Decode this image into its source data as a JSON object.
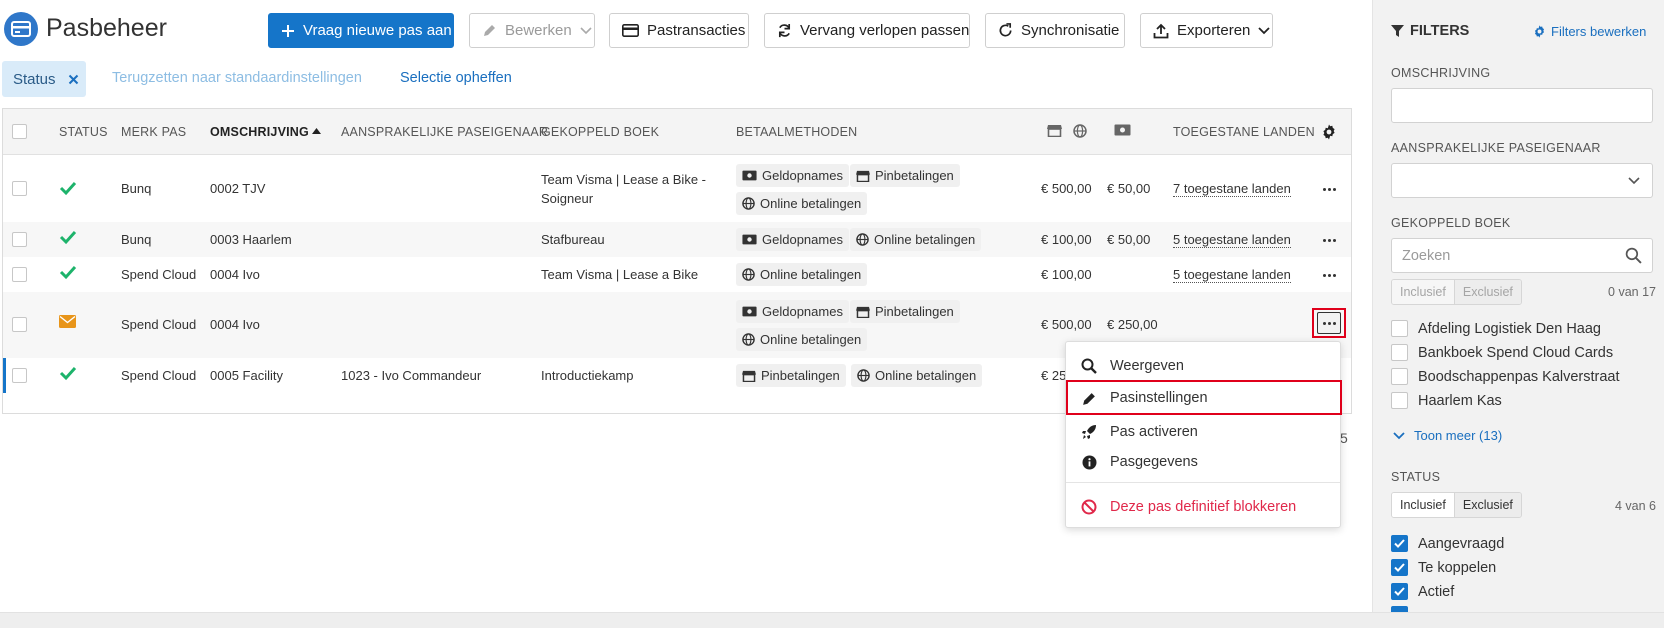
{
  "header": {
    "title": "Pasbeheer",
    "buttons": {
      "new_card": "Vraag nieuwe pas aan",
      "edit": "Bewerken",
      "transactions": "Pastransacties",
      "replace_expired": "Vervang verlopen passen",
      "sync": "Synchronisatie",
      "export": "Exporteren"
    }
  },
  "filters_bar": {
    "status_chip": "Status",
    "reset": "Terugzetten naar standaardinstellingen",
    "clear_selection": "Selectie opheffen"
  },
  "table": {
    "columns": {
      "status": "STATUS",
      "brand": "MERK PAS",
      "description": "OMSCHRIJVING",
      "owner": "AANSPRAKELIJKE PASEIGENAAR",
      "book": "GEKOPPELD BOEK",
      "payment_methods": "BETAALMETHODEN",
      "countries": "TOEGESTANE LANDEN"
    },
    "rows": [
      {
        "status": "active",
        "brand": "Bunq",
        "description": "0002 TJV",
        "owner": "",
        "book": "Team Visma | Lease a Bike - Soigneur",
        "methods": [
          "Geldopnames",
          "Pinbetalingen",
          "Online betalingen"
        ],
        "limit_a": "€ 500,00",
        "limit_b": "€ 50,00",
        "countries": "7 toegestane landen"
      },
      {
        "status": "active",
        "brand": "Bunq",
        "description": "0003 Haarlem",
        "owner": "",
        "book": "Stafbureau",
        "methods": [
          "Geldopnames",
          "Online betalingen"
        ],
        "limit_a": "€ 100,00",
        "limit_b": "€ 50,00",
        "countries": "5 toegestane landen"
      },
      {
        "status": "active",
        "brand": "Spend Cloud",
        "description": "0004 Ivo",
        "owner": "",
        "book": "Team Visma | Lease a Bike",
        "methods": [
          "Online betalingen"
        ],
        "limit_a": "€ 100,00",
        "limit_b": "",
        "countries": "5 toegestane landen"
      },
      {
        "status": "mail",
        "brand": "Spend Cloud",
        "description": "0004 Ivo",
        "owner": "",
        "book": "",
        "methods": [
          "Geldopnames",
          "Pinbetalingen",
          "Online betalingen"
        ],
        "limit_a": "€ 500,00",
        "limit_b": "€ 250,00",
        "countries": ""
      },
      {
        "status": "active",
        "brand": "Spend Cloud",
        "description": "0005 Facility",
        "owner": "1023 - Ivo Commandeur",
        "book": "Introductiekamp",
        "methods": [
          "Pinbetalingen",
          "Online betalingen"
        ],
        "limit_a": "€ 25",
        "limit_b": "",
        "countries": ""
      }
    ],
    "pagination_fragment": "5"
  },
  "context_menu": {
    "view": "Weergeven",
    "settings": "Pasinstellingen",
    "activate": "Pas activeren",
    "details": "Pasgegevens",
    "block": "Deze pas definitief blokkeren"
  },
  "right_panel": {
    "title": "FILTERS",
    "edit_filters": "Filters bewerken",
    "description_label": "OMSCHRIJVING",
    "owner_label": "AANSPRAKELIJKE PASEIGENAAR",
    "book_label": "GEKOPPELD BOEK",
    "book_search_placeholder": "Zoeken",
    "inclusive": "Inclusief",
    "exclusive": "Exclusief",
    "book_count": "0 van 17",
    "books": [
      "Afdeling Logistiek Den Haag",
      "Bankboek Spend Cloud Cards",
      "Boodschappenpas Kalverstraat",
      "Haarlem Kas"
    ],
    "show_more": "Toon meer (13)",
    "status_label": "STATUS",
    "status_count": "4 van 6",
    "statuses": [
      "Aangevraagd",
      "Te koppelen",
      "Actief"
    ]
  },
  "colors": {
    "primary": "#1575c9",
    "success": "#1db36b",
    "warning": "#e8951a",
    "danger": "#e0284a"
  }
}
